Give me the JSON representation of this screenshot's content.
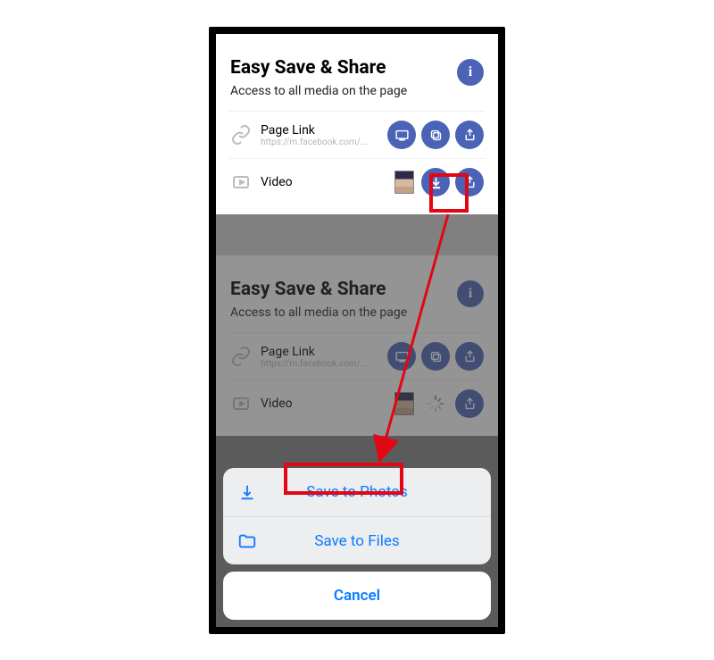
{
  "card": {
    "title": "Easy Save & Share",
    "subtitle": "Access to all media on the page",
    "info_label": "i"
  },
  "rows": {
    "link": {
      "label": "Page Link",
      "url": "https://m.facebook.com/..."
    },
    "video": {
      "label": "Video"
    }
  },
  "sheet": {
    "save_photos": "Save to Photos",
    "save_files": "Save to Files",
    "cancel": "Cancel"
  },
  "colors": {
    "accent": "#4a63b7",
    "ios_blue": "#0a7aff",
    "highlight": "#e30613"
  }
}
